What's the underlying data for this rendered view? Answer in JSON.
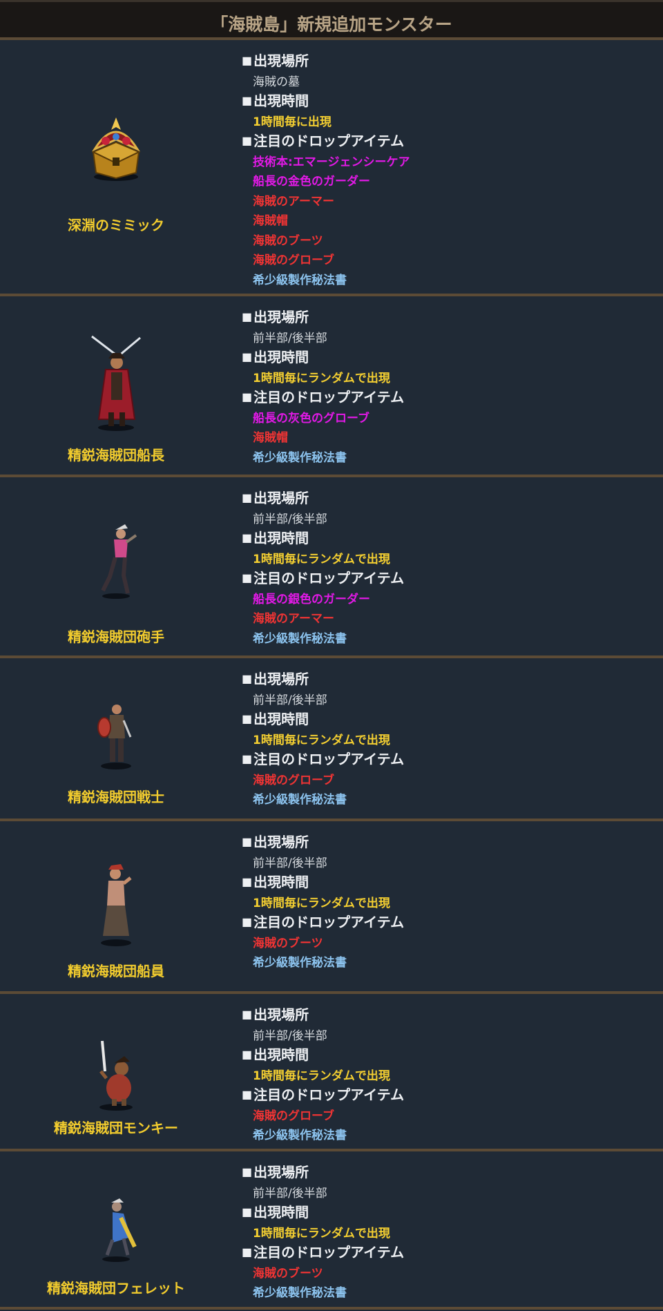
{
  "page_title": "「海賊島」新規追加モンスター",
  "labels": {
    "location": "出現場所",
    "time": "出現時間",
    "drops": "注目のドロップアイテム",
    "bullet": "■"
  },
  "colors": {
    "background": "#202a36",
    "divider": "#5c4b36",
    "name": "#f2cc2e",
    "time": "#f4cf31",
    "unique_item": "#e219e6",
    "legendary_item": "#ef3434",
    "rare_item": "#8cc3ee"
  },
  "monsters": [
    {
      "name": "深淵のミミック",
      "icon": "treasure-chest-mimic",
      "location": "海賊の墓",
      "time": "1時間毎に出現",
      "drops": [
        {
          "text": "技術本:エマージェンシーケア",
          "color": "magenta"
        },
        {
          "text": "船長の金色のガーダー",
          "color": "magenta"
        },
        {
          "text": "海賊のアーマー",
          "color": "red"
        },
        {
          "text": "海賊帽",
          "color": "red"
        },
        {
          "text": "海賊のブーツ",
          "color": "red"
        },
        {
          "text": "海賊のグローブ",
          "color": "red"
        },
        {
          "text": "希少級製作秘法書",
          "color": "blue"
        }
      ]
    },
    {
      "name": "精鋭海賊団船長",
      "icon": "pirate-captain",
      "location": "前半部/後半部",
      "time": "1時間毎にランダムで出現",
      "drops": [
        {
          "text": "船長の灰色のグローブ",
          "color": "magenta"
        },
        {
          "text": "海賊帽",
          "color": "red"
        },
        {
          "text": "希少級製作秘法書",
          "color": "blue"
        }
      ]
    },
    {
      "name": "精鋭海賊団砲手",
      "icon": "pirate-gunner",
      "location": "前半部/後半部",
      "time": "1時間毎にランダムで出現",
      "drops": [
        {
          "text": "船長の銀色のガーダー",
          "color": "magenta"
        },
        {
          "text": "海賊のアーマー",
          "color": "red"
        },
        {
          "text": "希少級製作秘法書",
          "color": "blue"
        }
      ]
    },
    {
      "name": "精鋭海賊団戦士",
      "icon": "pirate-warrior",
      "location": "前半部/後半部",
      "time": "1時間毎にランダムで出現",
      "drops": [
        {
          "text": "海賊のグローブ",
          "color": "red"
        },
        {
          "text": "希少級製作秘法書",
          "color": "blue"
        }
      ]
    },
    {
      "name": "精鋭海賊団船員",
      "icon": "pirate-crew",
      "location": "前半部/後半部",
      "time": "1時間毎にランダムで出現",
      "drops": [
        {
          "text": "海賊のブーツ",
          "color": "red"
        },
        {
          "text": "希少級製作秘法書",
          "color": "blue"
        }
      ]
    },
    {
      "name": "精鋭海賊団モンキー",
      "icon": "pirate-monkey",
      "location": "前半部/後半部",
      "time": "1時間毎にランダムで出現",
      "drops": [
        {
          "text": "海賊のグローブ",
          "color": "red"
        },
        {
          "text": "希少級製作秘法書",
          "color": "blue"
        }
      ]
    },
    {
      "name": "精鋭海賊団フェレット",
      "icon": "pirate-ferret",
      "location": "前半部/後半部",
      "time": "1時間毎にランダムで出現",
      "drops": [
        {
          "text": "海賊のブーツ",
          "color": "red"
        },
        {
          "text": "希少級製作秘法書",
          "color": "blue"
        }
      ]
    }
  ]
}
